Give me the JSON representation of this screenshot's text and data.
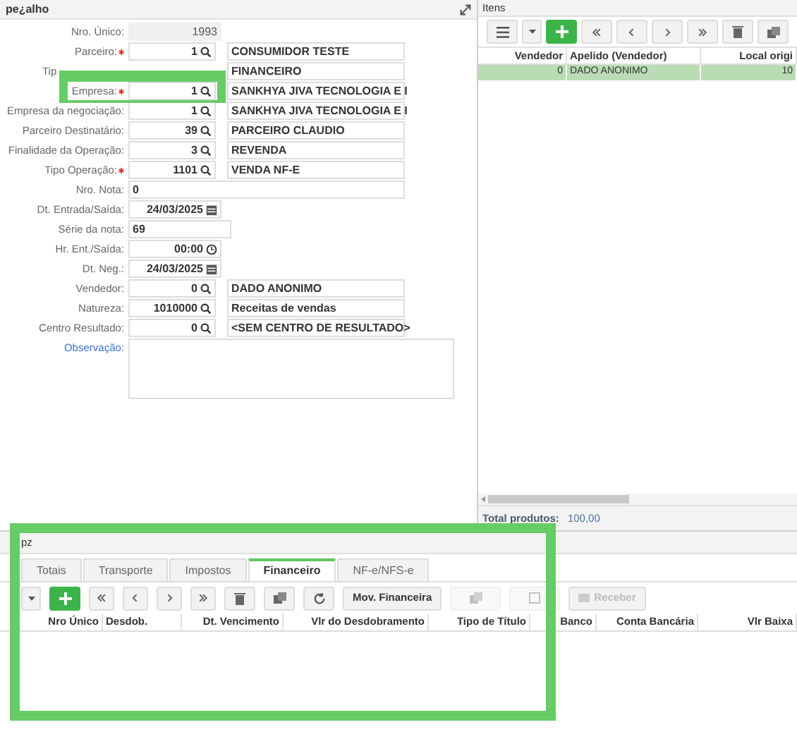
{
  "header_panel": {
    "title": "pe¿alho",
    "fields": [
      {
        "kind": "readonly",
        "label": "Nro. Único:",
        "required": false,
        "value": "1993"
      },
      {
        "kind": "lookup",
        "label": "Parceiro:",
        "required": true,
        "value": "1",
        "description": "CONSUMIDOR TESTE"
      },
      {
        "kind": "lookup",
        "label": "Tip",
        "required": false,
        "partial": true,
        "description": "FINANCEIRO"
      },
      {
        "kind": "lookup",
        "label": "Empresa:",
        "required": true,
        "value": "1",
        "description": "SANKHYA JIVA TECNOLOGIA E I"
      },
      {
        "kind": "lookup",
        "label": "Empresa da negociação:",
        "required": false,
        "value": "1",
        "description": "SANKHYA JIVA TECNOLOGIA E I"
      },
      {
        "kind": "lookup",
        "label": "Parceiro Destinatário:",
        "required": false,
        "value": "39",
        "description": "PARCEIRO CLAUDIO"
      },
      {
        "kind": "lookup",
        "label": "Finalidade da Operação:",
        "required": false,
        "value": "3",
        "description": "REVENDA"
      },
      {
        "kind": "lookup",
        "label": "Tipo Operação:",
        "required": true,
        "value": "1101",
        "description": "VENDA NF-E"
      },
      {
        "kind": "wide",
        "label": "Nro. Nota:",
        "required": false,
        "value": "0"
      },
      {
        "kind": "date",
        "label": "Dt. Entrada/Saída:",
        "required": false,
        "value": "24/03/2025"
      },
      {
        "kind": "short",
        "label": "Série da nota:",
        "required": false,
        "value": "69"
      },
      {
        "kind": "time",
        "label": "Hr. Ent./Saída:",
        "required": false,
        "value": "00:00"
      },
      {
        "kind": "date",
        "label": "Dt. Neg.:",
        "required": false,
        "value": "24/03/2025"
      },
      {
        "kind": "lookup",
        "label": "Vendedor:",
        "required": false,
        "value": "0",
        "description": "DADO ANONIMO"
      },
      {
        "kind": "lookup",
        "label": "Natureza:",
        "required": false,
        "value": "1010000",
        "description": "Receitas de vendas"
      },
      {
        "kind": "lookup",
        "label": "Centro Resultado:",
        "required": false,
        "value": "0",
        "description": "<SEM CENTRO DE RESULTADO>"
      },
      {
        "kind": "textarea",
        "label": "Observação:",
        "required": false
      }
    ]
  },
  "items_panel": {
    "title": "Itens",
    "columns": [
      "Vendedor",
      "Apelido (Vendedor)",
      "Local origi"
    ],
    "rows": [
      {
        "selected": true,
        "cells": [
          "0",
          "DADO ANONIMO",
          "10"
        ]
      }
    ],
    "total_label": "Total produtos:",
    "total_value": "100,00"
  },
  "bottom_panel": {
    "title": "pz",
    "tabs": [
      {
        "label": "Totais",
        "selected": false
      },
      {
        "label": "Transporte",
        "selected": false
      },
      {
        "label": "Impostos",
        "selected": false
      },
      {
        "label": "Financeiro",
        "selected": true
      },
      {
        "label": "NF-e/NFS-e",
        "selected": false
      }
    ],
    "buttons": [
      {
        "label": "Mov. Financeira",
        "disabled": false
      },
      {
        "label": "Receber",
        "disabled": true
      }
    ],
    "columns": [
      "Nro Único",
      "Desdob.",
      "Dt. Vencimento",
      "Vlr do Desdobramento",
      "Tipo de Título",
      "Banco",
      "Conta Bancária",
      "Vlr Baixa"
    ]
  }
}
